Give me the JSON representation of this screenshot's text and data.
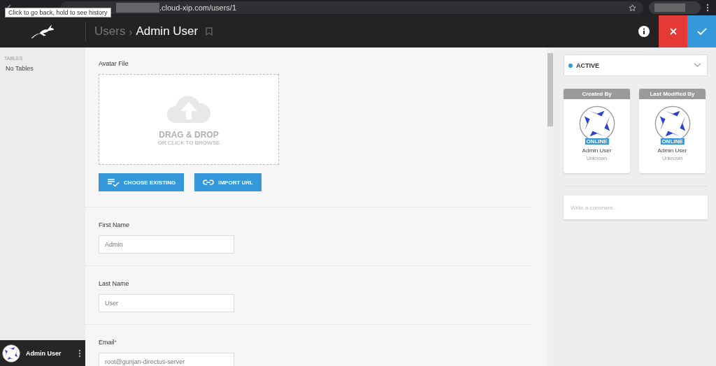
{
  "browser": {
    "url": ".cloud-xip.com/users/1",
    "tooltip": "Click to go back, hold to see history"
  },
  "header": {
    "breadcrumb": "Users",
    "separator": "›",
    "title": "Admin User"
  },
  "sidebar": {
    "section": "TABLES",
    "empty": "No Tables",
    "user": {
      "name": "Admin User"
    }
  },
  "avatar": {
    "label": "Avatar File",
    "drop_title": "DRAG & DROP",
    "drop_subtitle": "OR CLICK TO BROWSE",
    "buttons": [
      {
        "kind": "choose",
        "label": "CHOOSE EXISTING"
      },
      {
        "kind": "link",
        "label": "IMPORT URL"
      }
    ]
  },
  "fields": [
    {
      "label": "First Name",
      "value": "Admin"
    },
    {
      "label": "Last Name",
      "value": "User"
    },
    {
      "label": "Email",
      "required_mark": "*",
      "value": "root@gunjan-directus-server"
    }
  ],
  "status": {
    "label": "ACTIVE",
    "color": "#3498db"
  },
  "cards": [
    {
      "title": "Created By",
      "badge": "ONLINE",
      "name": "Admin User",
      "subtitle": "Unknown"
    },
    {
      "title": "Last Modified By",
      "badge": "ONLINE",
      "name": "Admin User",
      "subtitle": "Unknown"
    }
  ],
  "comment": {
    "placeholder": "Write a comment..."
  }
}
